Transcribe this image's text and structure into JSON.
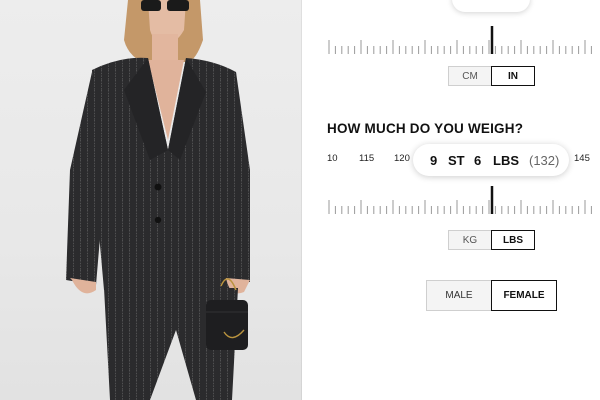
{
  "photo": {
    "alt_subject": "model-in-pinstripe-suit",
    "colors": {
      "background": "#e9e9e9",
      "suit": "#2a2a2c",
      "hair": "#c99a6a",
      "skin": "#e0b7a0"
    }
  },
  "height": {
    "units": [
      {
        "label": "CM",
        "selected": false
      },
      {
        "label": "IN",
        "selected": true
      }
    ]
  },
  "weight": {
    "question": "HOW MUCH DO YOU WEIGH?",
    "scale_labels": [
      "10",
      "115",
      "120",
      "145"
    ],
    "value": {
      "stones": "9",
      "stones_unit": "ST",
      "pounds": "6",
      "pounds_unit": "LBS",
      "total": "(132)"
    },
    "units": [
      {
        "label": "KG",
        "selected": false
      },
      {
        "label": "LBS",
        "selected": true
      }
    ]
  },
  "gender": {
    "options": [
      {
        "label": "MALE",
        "selected": false
      },
      {
        "label": "FEMALE",
        "selected": true
      }
    ]
  },
  "colors": {
    "accent": "#111111",
    "border": "#cfcfcf",
    "inactive_bg": "#f4f4f4"
  }
}
